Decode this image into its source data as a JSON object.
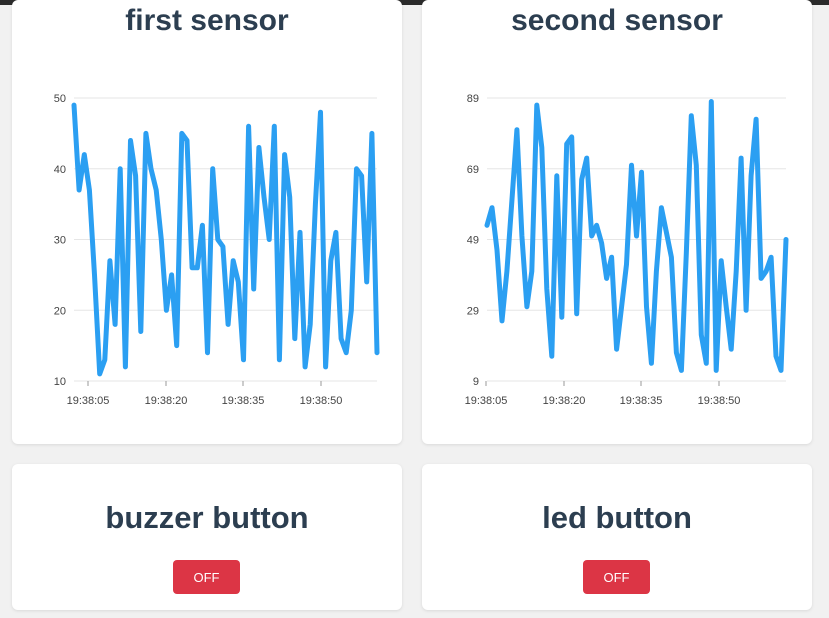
{
  "chart_data": [
    {
      "type": "line",
      "title": "first sensor",
      "color": "#2b9ff2",
      "ylim": [
        10,
        50
      ],
      "yticks": [
        "50",
        "40",
        "30",
        "20",
        "10"
      ],
      "xticks": [
        "19:38:05",
        "19:38:20",
        "19:38:35",
        "19:38:50"
      ],
      "series": [
        {
          "values": [
            49,
            37,
            42,
            37,
            25,
            11,
            13,
            27,
            18,
            40,
            12,
            44,
            39,
            17,
            45,
            40,
            37,
            30,
            20,
            25,
            15,
            45,
            44,
            26,
            26,
            32,
            14,
            40,
            30,
            29,
            18,
            27,
            24,
            13,
            46,
            23,
            43,
            36,
            30,
            46,
            13,
            42,
            36,
            16,
            31,
            12,
            18,
            35,
            48,
            12,
            27,
            31,
            16,
            14,
            20,
            40,
            39,
            24,
            45,
            14
          ]
        }
      ],
      "grid": true
    },
    {
      "type": "line",
      "title": "second sensor",
      "color": "#2b9ff2",
      "ylim": [
        9,
        89
      ],
      "yticks": [
        "89",
        "69",
        "49",
        "29",
        "9"
      ],
      "xticks": [
        "19:38:05",
        "19:38:20",
        "19:38:35",
        "19:38:50"
      ],
      "series": [
        {
          "values": [
            53,
            58,
            46,
            26,
            40,
            60,
            80,
            50,
            30,
            40,
            87,
            75,
            35,
            16,
            67,
            27,
            76,
            78,
            28,
            66,
            72,
            50,
            53,
            48,
            38,
            44,
            18,
            30,
            42,
            70,
            50,
            68,
            30,
            14,
            40,
            58,
            51,
            44,
            17,
            12,
            45,
            84,
            70,
            22,
            14,
            88,
            12,
            43,
            30,
            18,
            40,
            72,
            29,
            67,
            83,
            38,
            40,
            44,
            16,
            12,
            49
          ]
        }
      ],
      "grid": true
    }
  ],
  "buzzer": {
    "title": "buzzer button",
    "state_label": "OFF"
  },
  "led": {
    "title": "led button",
    "state_label": "OFF"
  },
  "colors": {
    "line": "#2b9ff2",
    "button_off": "#dc3545",
    "title": "#2c3e50"
  }
}
